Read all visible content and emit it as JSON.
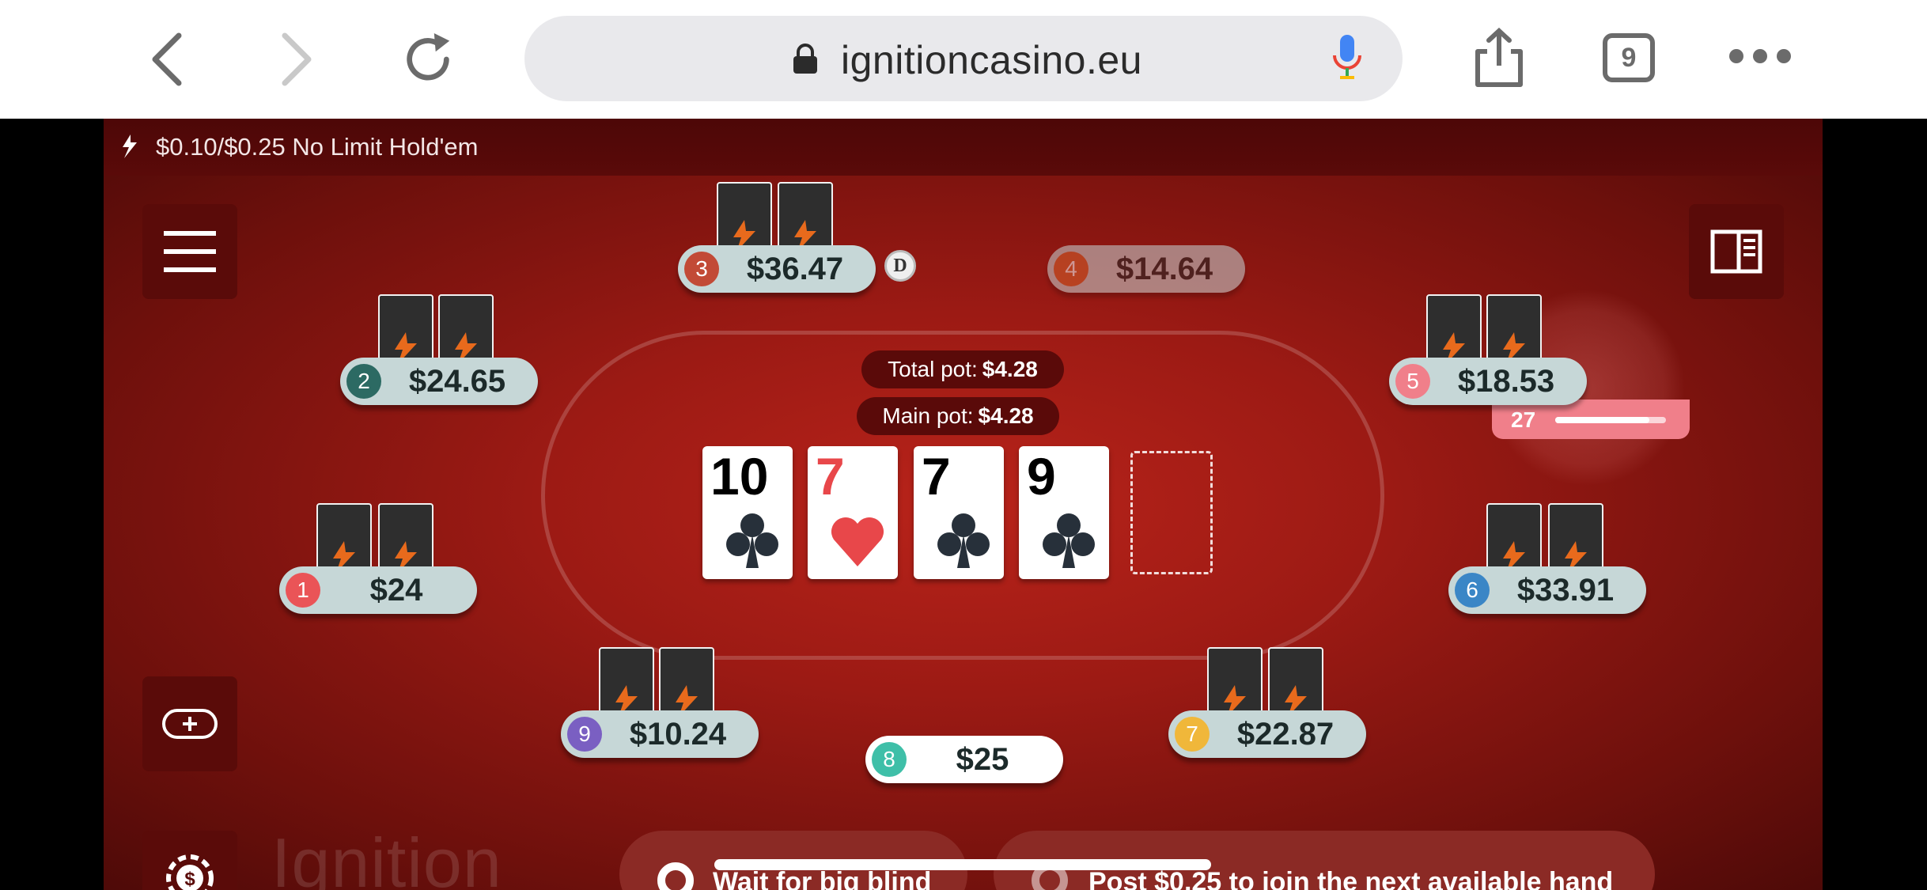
{
  "browser": {
    "url": "ignitioncasino.eu",
    "tab_count": "9"
  },
  "table": {
    "title": "$0.10/$0.25 No Limit Hold'em",
    "total_pot_label": "Total pot:",
    "total_pot_value": "$4.28",
    "main_pot_label": "Main pot:",
    "main_pot_value": "$4.28",
    "dealer_label": "D",
    "timer_value": "27",
    "timer_fraction": 0.85,
    "logo_text": "Ignition"
  },
  "board": [
    {
      "rank": "10",
      "suit": "clubs",
      "color": "#27303a"
    },
    {
      "rank": "7",
      "suit": "hearts",
      "color": "#e8474a"
    },
    {
      "rank": "7",
      "suit": "clubs",
      "color": "#27303a"
    },
    {
      "rank": "9",
      "suit": "clubs",
      "color": "#27303a"
    }
  ],
  "seats": {
    "s1": {
      "num": "1",
      "stack": "$24",
      "color": "#ea5457"
    },
    "s2": {
      "num": "2",
      "stack": "$24.65",
      "color": "#2c6a63"
    },
    "s3": {
      "num": "3",
      "stack": "$36.47",
      "color": "#c24a36"
    },
    "s4": {
      "num": "4",
      "stack": "$14.64",
      "color": "#d6642e"
    },
    "s5": {
      "num": "5",
      "stack": "$18.53",
      "color": "#f07f8a"
    },
    "s6": {
      "num": "6",
      "stack": "$33.91",
      "color": "#3a86c6"
    },
    "s7": {
      "num": "7",
      "stack": "$22.87",
      "color": "#f0b73a"
    },
    "s8": {
      "num": "8",
      "stack": "$25",
      "color": "#3fbfa8"
    },
    "s9": {
      "num": "9",
      "stack": "$10.24",
      "color": "#7a5fc2"
    }
  },
  "actions": {
    "wait_bb": "Wait for big blind",
    "post_blind": "Post $0.25 to join the next available hand"
  },
  "colors": {
    "felt": "#9c1a14",
    "seat_bg": "#c6d7d7",
    "card_back": "#2e2e2e",
    "card_back_logo": "#e86a1c"
  }
}
